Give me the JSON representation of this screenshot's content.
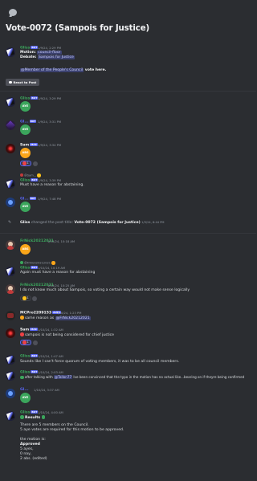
{
  "thread": {
    "title": "Vote-0072 (Sampois for Justice)"
  },
  "users": {
    "gliss": "Gliss",
    "sam": "Sam",
    "fn": "FrNick2021",
    "fn2021": "FrNick20212021",
    "mc": "MCPro2209153",
    "blue": "Gl..."
  },
  "tags": {
    "bot": "BOT",
    "maxx": "MAX",
    "auto": "AUTO"
  },
  "messages": [
    {
      "time": "1/9/24, 2:29 PM",
      "motion_label": "Motion:",
      "motion_value": "council-floor",
      "debate_label": "Debate:",
      "debate_value": "Sampois for Justice",
      "mention": "@Member of the People's Council",
      "mention_suffix": " vote here."
    },
    {
      "time": "1/9/24, 3:29 PM",
      "vote": "AYE"
    },
    {
      "time": "1/9/24, 3:31 PM",
      "vote": "AYE"
    },
    {
      "time": "1/9/24, 3:34 PM",
      "vote": "ABS",
      "reaction_count": "1"
    },
    {
      "time": "1/9/24, 3:39 PM",
      "reply_text": "@Sam... ",
      "body": "Must have a reason for abstaining."
    },
    {
      "time": "1/9/24, 7:48 PM",
      "vote": "AYE"
    },
    {
      "system_prefix": "Gliss",
      "system_text": " changed the post title: ",
      "system_value": "Vote-0072 (Sampois for Justice)",
      "time": "1/9/24, 8:44 PM"
    },
    {
      "time": "1/10/24, 10:18 AM",
      "vote": "ABS"
    },
    {
      "reply_text": "@FrNick20212021",
      "time": "1/10/24, 10:19 AM",
      "body": "Again must have a reason for abstaining"
    },
    {
      "time": "1/10/24, 10:25 AM",
      "body": "I do not know much about Sampois, so voting a certain way would not make sense logically",
      "reaction_count": "1"
    },
    {
      "time": "1/10/24, 1:23 PM",
      "body_prefix": "same reason as ",
      "mention": "@FrNick20212021"
    },
    {
      "time": "1/10/24, 1:32 AM",
      "body": "sampois is not being considered for chief justice",
      "reaction_count": "1"
    },
    {
      "time": "1/10/24, 1:47 AM",
      "body": "Sounds like I can't force quorum of voting members, it was to be all council members."
    },
    {
      "time": "1/10/24, 2:03 AM",
      "body_prefix": "after talking with ",
      "mention": "@Tallon77",
      "body_suffix": " Ive been convinced that the typo in the motion has no actual like...bearing on if theyre being confirmed"
    },
    {
      "time": "1/10/24, 3:37 AM",
      "vote": "AYE"
    },
    {
      "time": "1/10/24, 4:00 AM",
      "results_label": "Results",
      "lines": [
        "There are 5 members on the Council.",
        "5 aye votes are required for this motion to be approved.",
        "",
        "the motion is:",
        "Approved",
        "5 ayes,",
        "0 nay,",
        "2 abs. (edited)"
      ]
    }
  ],
  "buttons": {
    "react_to_post": "React to Post"
  },
  "icons": [
    "thread-icon",
    "channel-icon",
    "hash-icon",
    "pencil-icon",
    "smile-icon"
  ]
}
